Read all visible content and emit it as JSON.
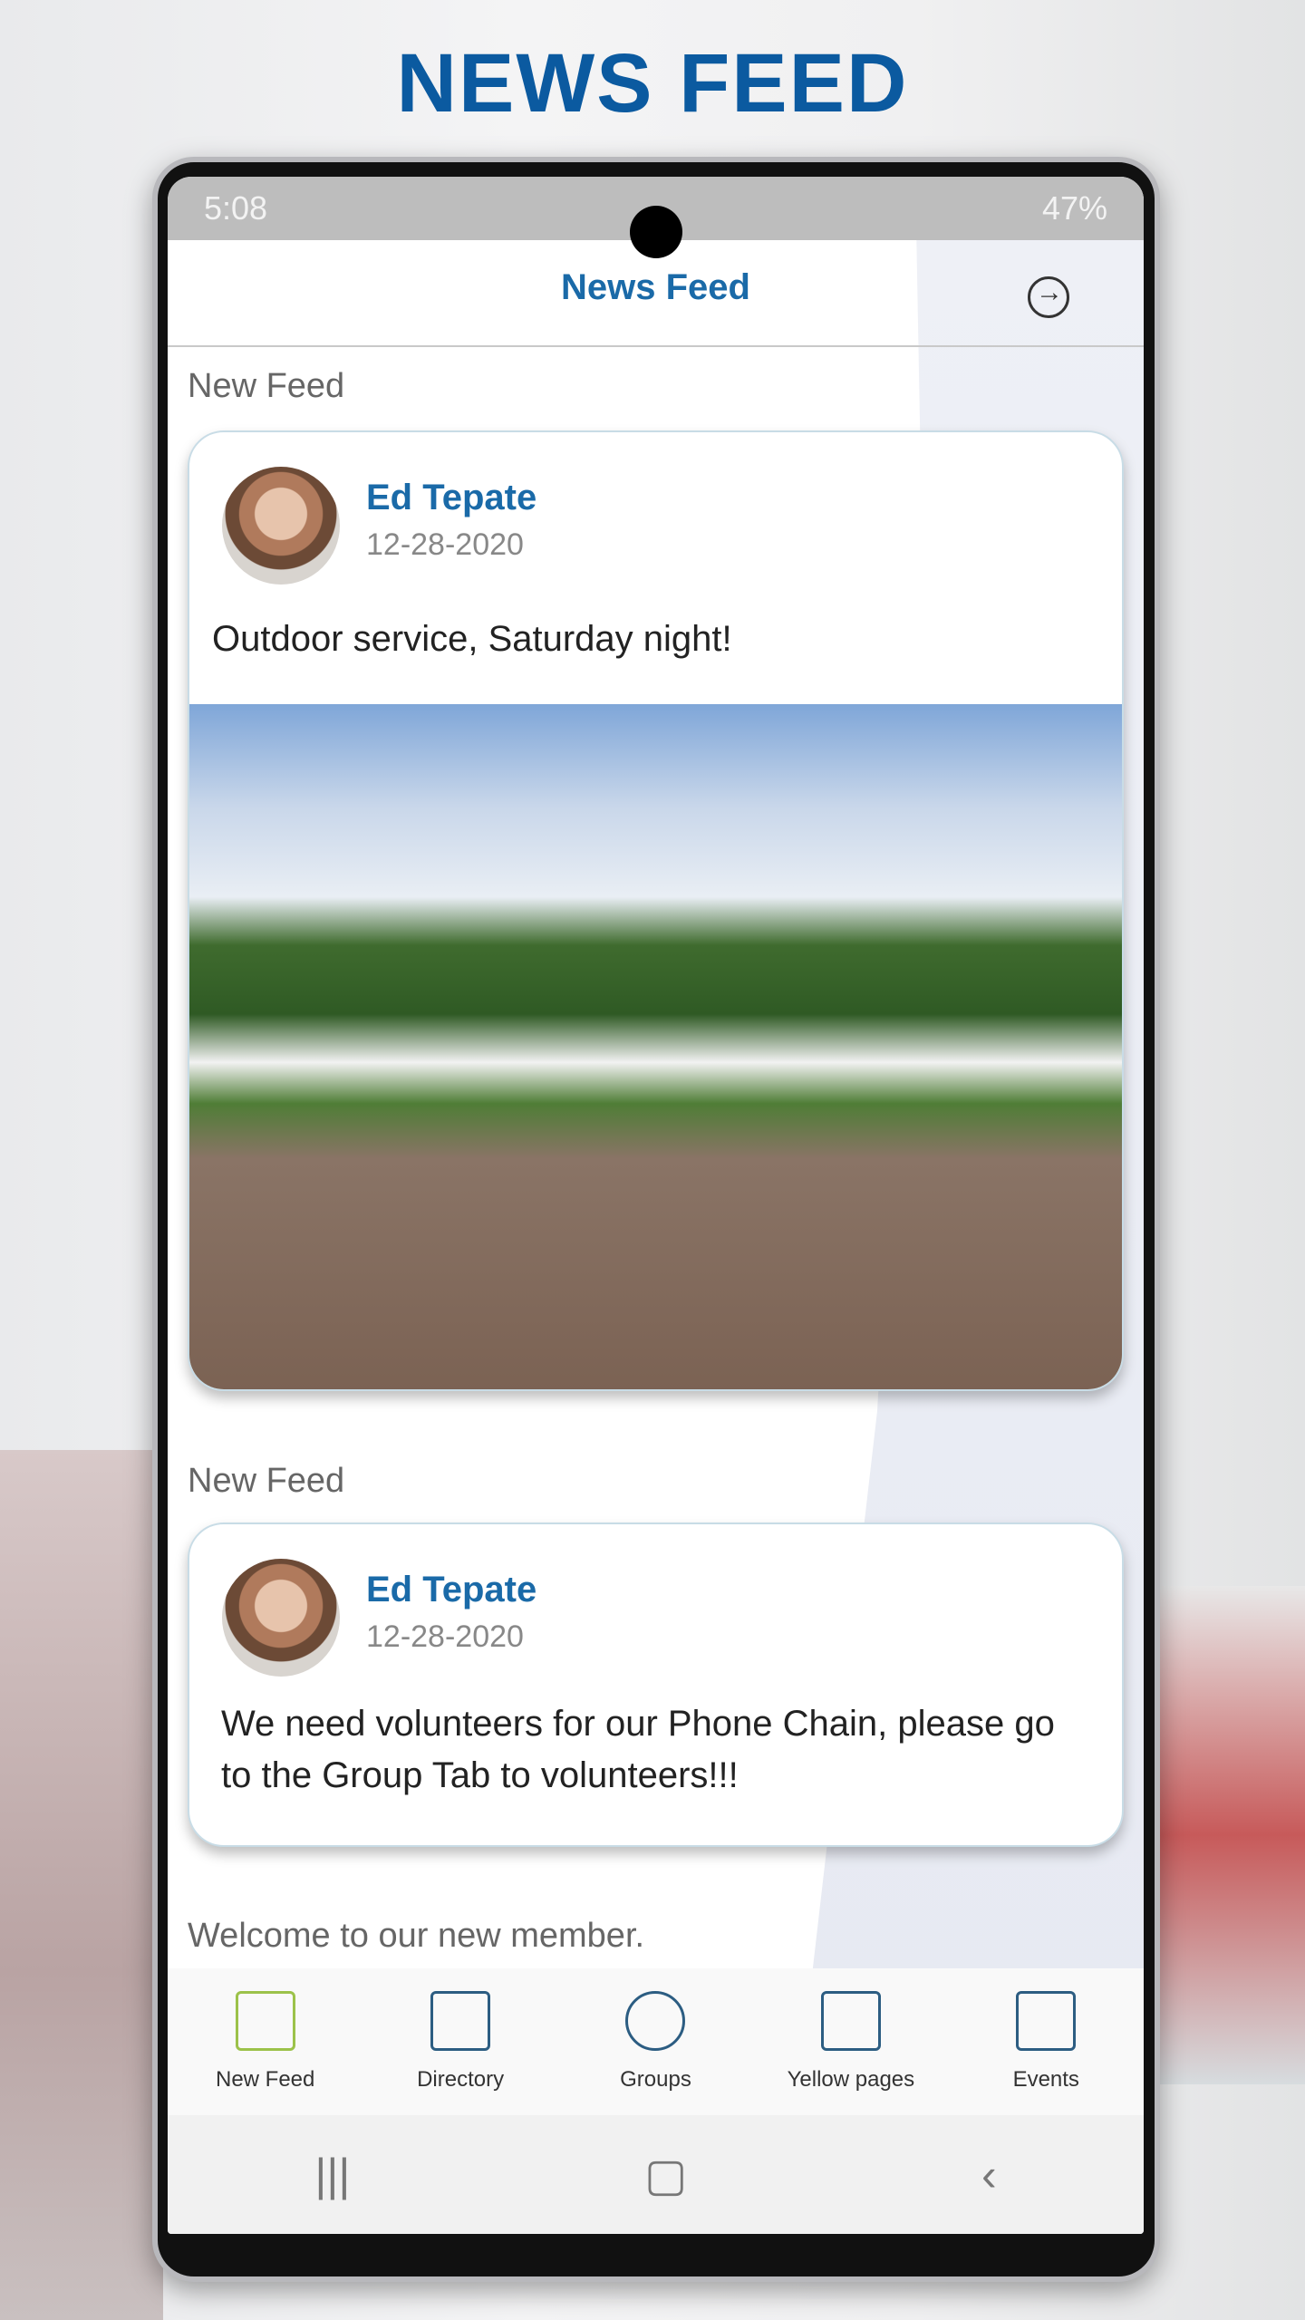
{
  "headline": "NEWS FEED",
  "status": {
    "time": "5:08",
    "battery": "47%"
  },
  "appbar": {
    "title": "News Feed"
  },
  "feed": [
    {
      "section": "New Feed",
      "author": "Ed Tepate",
      "date": "12-28-2020",
      "text": "Outdoor service, Saturday night!"
    },
    {
      "section": "New Feed",
      "author": "Ed Tepate",
      "date": "12-28-2020",
      "text": "We need volunteers for our Phone Chain, please go to the Group Tab to volunteers!!!"
    }
  ],
  "welcome": "Welcome to our new member.",
  "nav": [
    {
      "label": "New Feed",
      "active": true
    },
    {
      "label": "Directory"
    },
    {
      "label": "Groups"
    },
    {
      "label": "Yellow pages"
    },
    {
      "label": "Events"
    }
  ],
  "sysnav": {
    "recents": "|||",
    "home": "▢",
    "back": "‹"
  }
}
